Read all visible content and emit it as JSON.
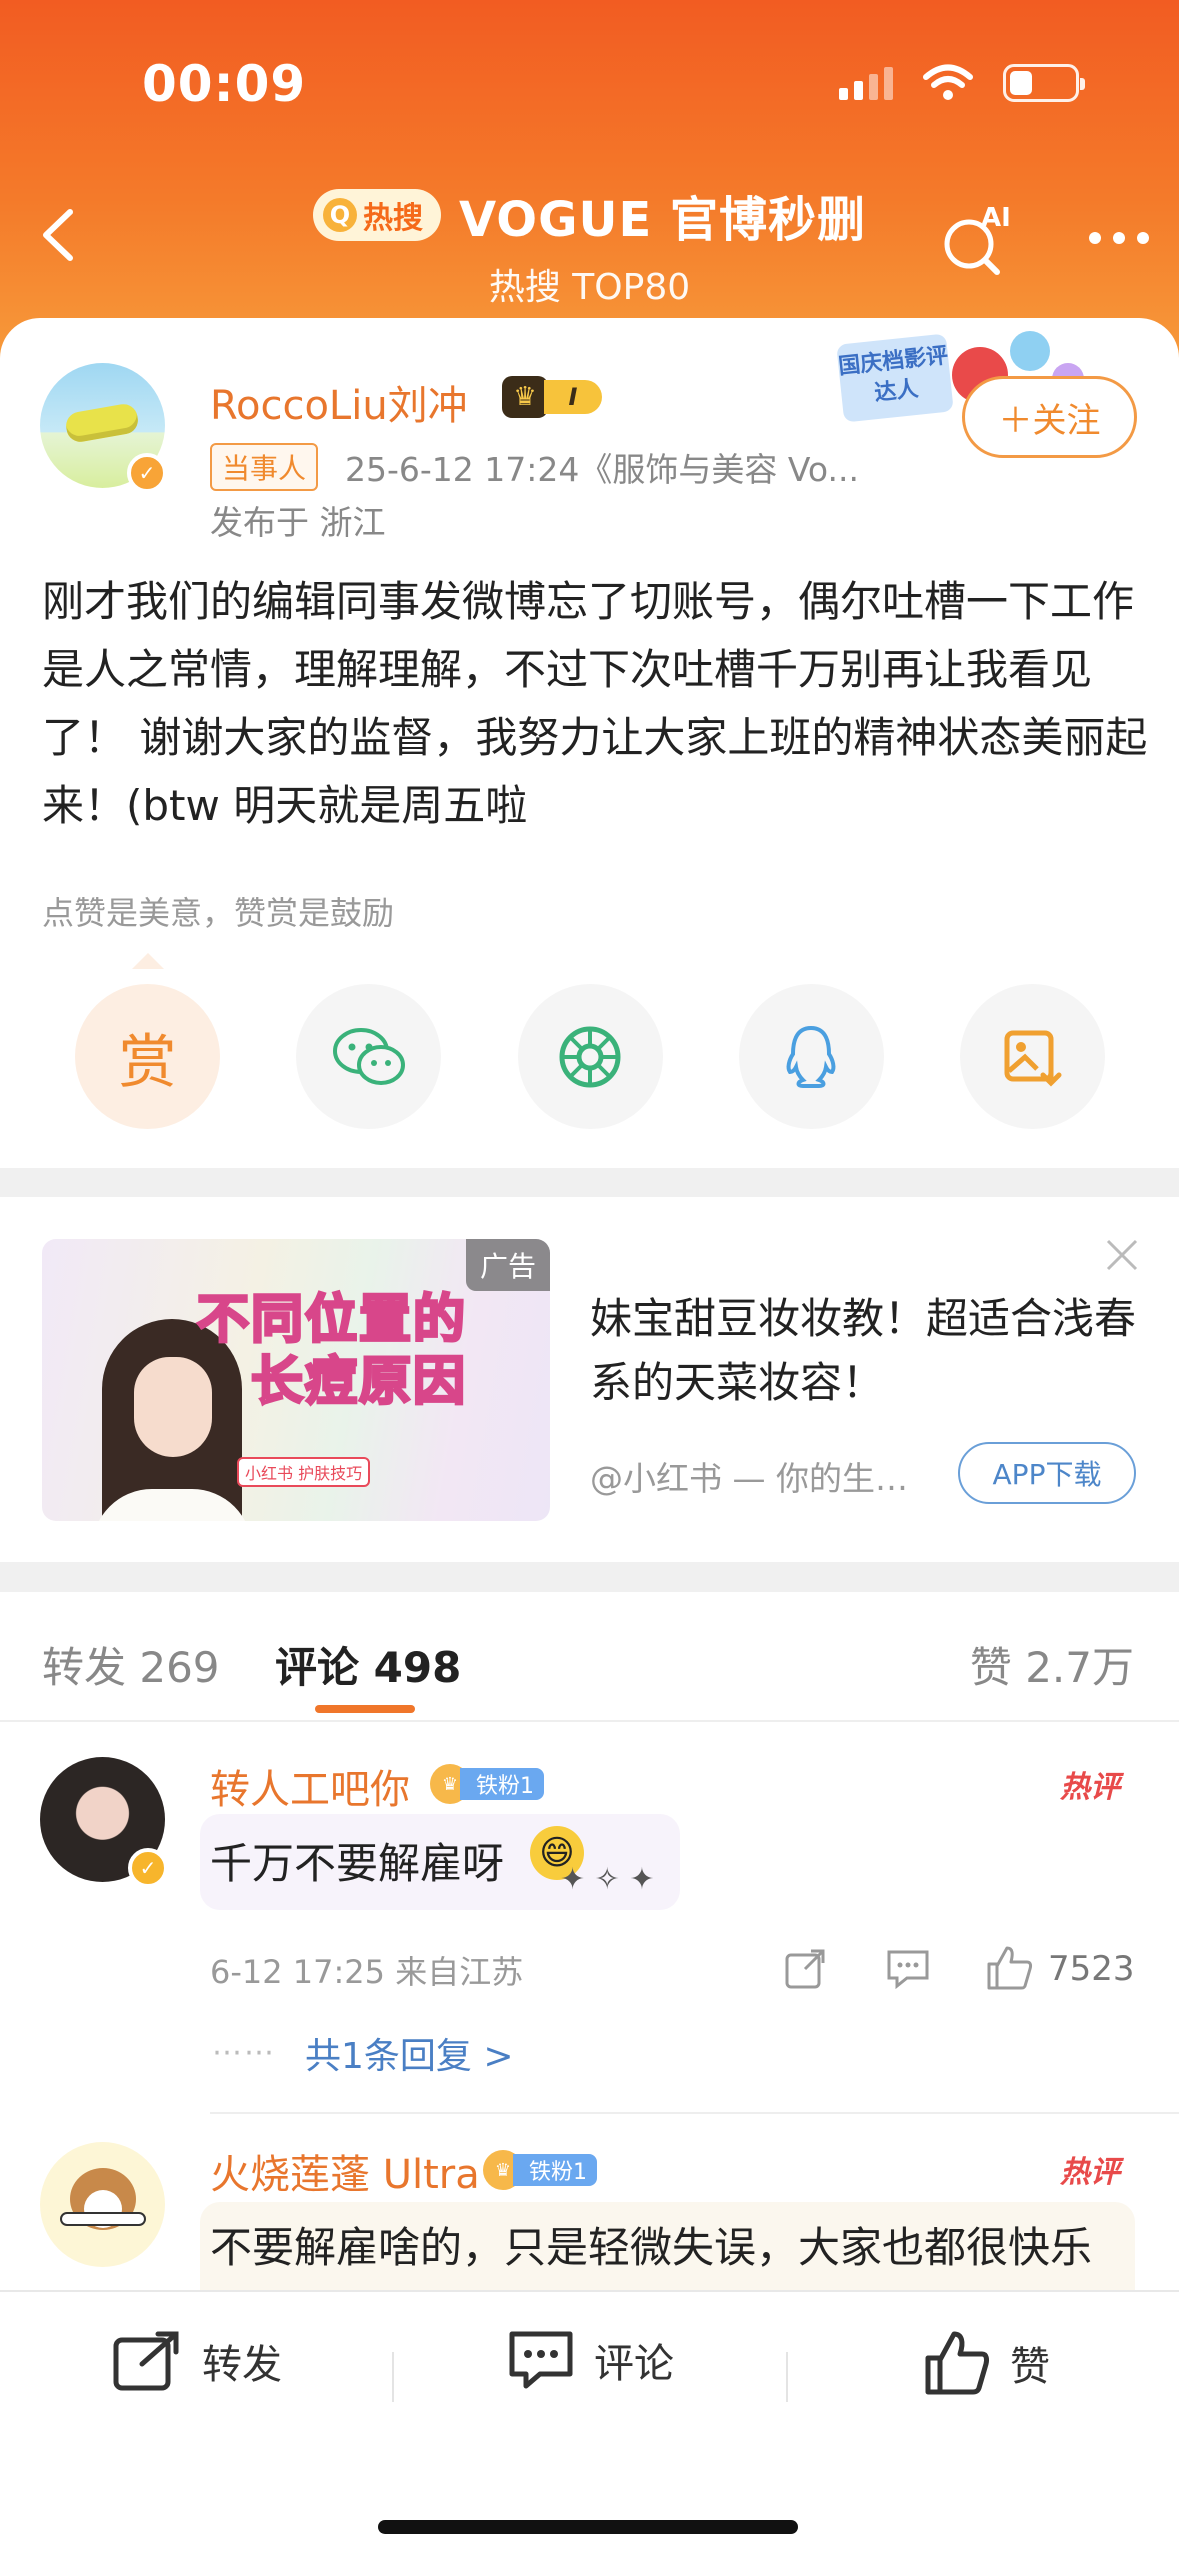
{
  "status_bar": {
    "time": "00:09"
  },
  "nav": {
    "hot_badge": "热搜",
    "title": "VOGUE 官博秒删",
    "subtitle": "热搜 TOP80",
    "ai_label": "AI"
  },
  "post": {
    "author": "RoccoLiu刘冲",
    "crown_level": "I",
    "party_tag": "当事人",
    "meta": "25-6-12 17:24《服饰与美容 Vo...",
    "location": "发布于 浙江",
    "deco_label": "国庆档影评达人",
    "follow_label": "＋关注",
    "text": "刚才我们的编辑同事发微博忘了切账号，偶尔吐槽一下工作是人之常情，理解理解，不过下次吐槽千万别再让我看见了！ 谢谢大家的监督，我努力让大家上班的精神状态美丽起来！(btw 明天就是周五啦",
    "reward_hint": "点赞是美意，赞赏是鼓励",
    "reward_label": "赏"
  },
  "ad": {
    "image_headline_1": "不同位置的",
    "image_headline_2": "长痘原因",
    "image_badge": "小红书  护肤技巧",
    "tag": "广告",
    "title": "妹宝甜豆妆妆教！超适合浅春系的天菜妆容！",
    "source": "@小红书 — 你的生活兴趣社区",
    "download_label": "APP下载"
  },
  "tabs": {
    "repost": "转发 269",
    "comment": "评论 498",
    "likes": "赞 2.7万"
  },
  "comments": [
    {
      "name": "转人工吧你",
      "fan_badge": "铁粉1",
      "hot": "热评",
      "text": "千万不要解雇呀",
      "meta": "6-12 17:25 来自江苏",
      "likes": "7523",
      "replies": "共1条回复 >"
    },
    {
      "name": "火烧莲蓬 Ultra",
      "fan_badge": "铁粉1",
      "hot": "热评",
      "text": "不要解雇啥的，只是轻微失误，大家也都很快乐呀"
    }
  ],
  "bottom_bar": {
    "repost": "转发",
    "comment": "评论",
    "like": "赞"
  },
  "colors": {
    "brand_orange": "#f25c22",
    "accent_name": "#e8762d",
    "link_blue": "#4a7fc4"
  }
}
